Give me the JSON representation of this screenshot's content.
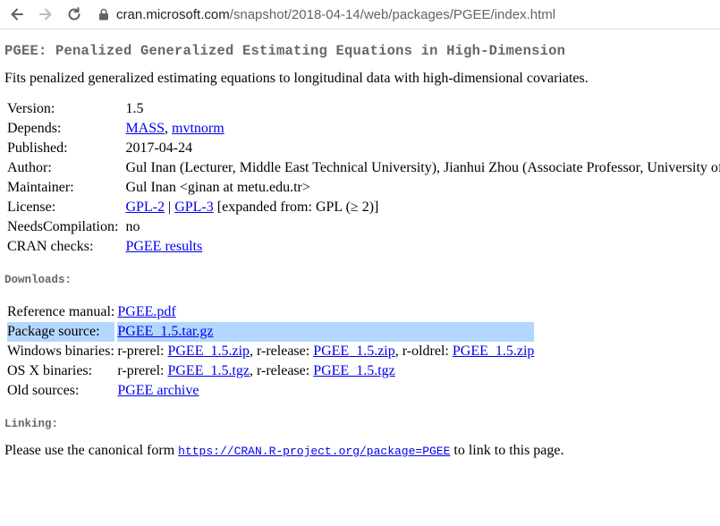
{
  "browser": {
    "url_host": "cran.microsoft.com",
    "url_path": "/snapshot/2018-04-14/web/packages/PGEE/index.html"
  },
  "page": {
    "title": "PGEE: Penalized Generalized Estimating Equations in High-Dimension",
    "description": "Fits penalized generalized estimating equations to longitudinal data with high-dimensional covariates.",
    "info": {
      "version_label": "Version:",
      "version": "1.5",
      "depends_label": "Depends:",
      "depends": [
        {
          "text": "MASS"
        },
        {
          "text": "mvtnorm"
        }
      ],
      "depends_sep": ", ",
      "published_label": "Published:",
      "published": "2017-04-24",
      "author_label": "Author:",
      "author": "Gul Inan (Lecturer, Middle East Technical University), Jianhui Zhou (Associate Professor, University of",
      "maintainer_label": "Maintainer:",
      "maintainer": "Gul Inan <ginan at metu.edu.tr>",
      "license_label": "License:",
      "license_link1": "GPL-2",
      "license_sep": " | ",
      "license_link2": "GPL-3",
      "license_extra": " [expanded from: GPL (≥ 2)]",
      "needs_label": "NeedsCompilation:",
      "needs": "no",
      "checks_label": "CRAN checks:",
      "checks_link": "PGEE results"
    },
    "downloads_heading": "Downloads:",
    "downloads": {
      "refman_label": "Reference manual:",
      "refman_link": "PGEE.pdf",
      "source_label": "Package source:",
      "source_link": "PGEE_1.5.tar.gz",
      "win_label": "Windows binaries:",
      "win_prerel": "r-prerel: ",
      "win_prerel_link": "PGEE_1.5.zip",
      "win_release": ", r-release: ",
      "win_release_link": "PGEE_1.5.zip",
      "win_oldrel": ", r-oldrel: ",
      "win_oldrel_link": "PGEE_1.5.zip",
      "osx_label": "OS X binaries:",
      "osx_prerel": "r-prerel: ",
      "osx_prerel_link": "PGEE_1.5.tgz",
      "osx_release": ", r-release: ",
      "osx_release_link": "PGEE_1.5.tgz",
      "old_label": "Old sources:",
      "old_link": "PGEE archive"
    },
    "linking_heading": "Linking:",
    "linking_pre": "Please use the canonical form ",
    "linking_url": "https://CRAN.R-project.org/package=PGEE",
    "linking_post": " to link to this page."
  },
  "icons": {
    "back": "arrow-left-icon",
    "forward": "arrow-right-icon",
    "reload": "reload-icon",
    "lock": "lock-icon"
  },
  "colors": {
    "link": "#0000ee",
    "heading": "#666666",
    "selection": "#b3d7fe"
  }
}
